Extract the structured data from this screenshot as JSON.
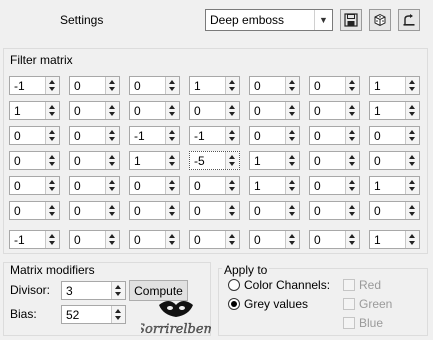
{
  "header": {
    "title": "Settings",
    "preset": "Deep emboss",
    "save_icon": "floppy-disk-icon",
    "random_icon": "dice-icon",
    "reset_icon": "reset-arrow-icon"
  },
  "filter_matrix": {
    "label": "Filter matrix",
    "rows": [
      [
        "-1",
        "0",
        "0",
        "1",
        "0",
        "0",
        "1"
      ],
      [
        "1",
        "0",
        "0",
        "0",
        "0",
        "0",
        "1"
      ],
      [
        "0",
        "0",
        "-1",
        "-1",
        "0",
        "0",
        "0"
      ],
      [
        "0",
        "0",
        "1",
        "-5",
        "1",
        "0",
        "0"
      ],
      [
        "0",
        "0",
        "0",
        "0",
        "1",
        "0",
        "1"
      ],
      [
        "0",
        "0",
        "0",
        "0",
        "0",
        "0",
        "0"
      ],
      [
        "-1",
        "0",
        "0",
        "0",
        "0",
        "0",
        "1"
      ]
    ]
  },
  "modifiers": {
    "label": "Matrix modifiers",
    "divisor_label": "Divisor:",
    "divisor_value": "3",
    "bias_label": "Bias:",
    "bias_value": "52",
    "compute_label": "Compute"
  },
  "apply_to": {
    "label": "Apply to",
    "color_channels_label": "Color Channels:",
    "grey_values_label": "Grey values",
    "selected": "Grey values",
    "red_label": "Red",
    "green_label": "Green",
    "blue_label": "Blue"
  },
  "watermark_text": "Sorrirelbem"
}
